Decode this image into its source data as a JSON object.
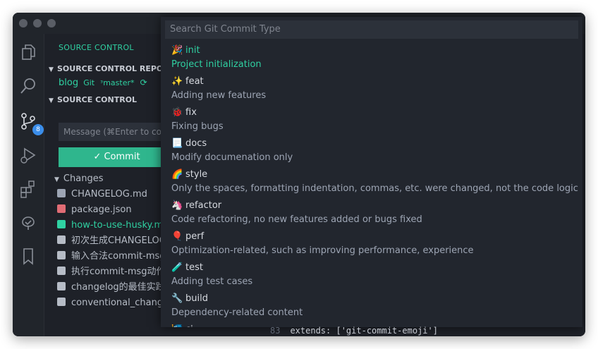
{
  "sidebar": {
    "title": "SOURCE CONTROL",
    "repos_header": "SOURCE CONTROL REPOSITORIES",
    "repo": {
      "name": "blog",
      "type": "Git",
      "branch": "master*"
    },
    "sc_header": "SOURCE CONTROL",
    "message_placeholder": "Message (⌘Enter to commit)",
    "commit_label": "✓ Commit",
    "changes_label": "Changes",
    "scm_badge": "8",
    "files": [
      {
        "name": "CHANGELOG.md",
        "color": "#9da5b4"
      },
      {
        "name": "package.json",
        "color": "#e06c75"
      },
      {
        "name": "how-to-use-husky.md",
        "color": "#2fd1a2"
      },
      {
        "name": "初次生成CHANGELOG.png",
        "color": "#b6bcc6"
      },
      {
        "name": "输入合法commit-msg.png",
        "color": "#b6bcc6"
      },
      {
        "name": "执行commit-msg动作.png",
        "color": "#b6bcc6"
      },
      {
        "name": "changelog的最佳实践.png",
        "color": "#b6bcc6"
      },
      {
        "name": "conventional_changelog.png",
        "color": "#b6bcc6"
      }
    ]
  },
  "palette": {
    "placeholder": "Search Git Commit Type",
    "items": [
      {
        "emoji": "🎉",
        "type": "init",
        "desc": "Project initialization"
      },
      {
        "emoji": "✨",
        "type": "feat",
        "desc": "Adding new features"
      },
      {
        "emoji": "🐞",
        "type": "fix",
        "desc": "Fixing bugs"
      },
      {
        "emoji": "📃",
        "type": "docs",
        "desc": "Modify documenation only"
      },
      {
        "emoji": "🌈",
        "type": "style",
        "desc": "Only the spaces, formatting indentation, commas, etc. were changed, not the code logic"
      },
      {
        "emoji": "🦄",
        "type": "refactor",
        "desc": "Code refactoring, no new features added or bugs fixed"
      },
      {
        "emoji": "🎈",
        "type": "perf",
        "desc": "Optimization-related, such as improving performance, experience"
      },
      {
        "emoji": "🧪",
        "type": "test",
        "desc": "Adding test cases"
      },
      {
        "emoji": "🔧",
        "type": "build",
        "desc": "Dependency-related content"
      },
      {
        "emoji": "🎏",
        "type": "ci",
        "desc": ""
      }
    ]
  },
  "editor": {
    "line_number": "83",
    "code_line": "extends: ['git-commit-emoji']"
  },
  "colors": {
    "accent": "#2fd1a2",
    "commit_button": "#2fb68d",
    "badge": "#3b8eea"
  }
}
